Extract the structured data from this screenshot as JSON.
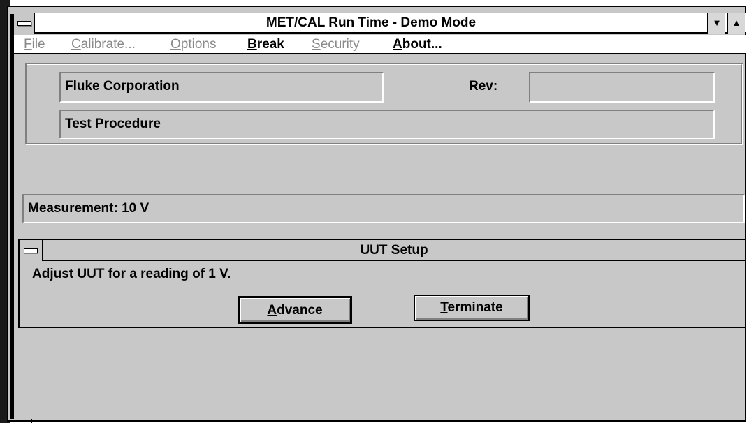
{
  "window": {
    "title": "MET/CAL Run Time - Demo Mode",
    "minimize_glyph": "▼",
    "maximize_glyph": "▲"
  },
  "menu": {
    "items": [
      {
        "underline": "F",
        "rest": "ile",
        "enabled": false
      },
      {
        "underline": "C",
        "rest": "alibrate...",
        "enabled": false
      },
      {
        "underline": "O",
        "rest": "ptions",
        "enabled": false
      },
      {
        "underline": "B",
        "rest": "reak",
        "enabled": true
      },
      {
        "underline": "S",
        "rest": "ecurity",
        "enabled": false
      },
      {
        "underline": "A",
        "rest": "bout...",
        "enabled": true
      }
    ]
  },
  "info": {
    "company": "Fluke Corporation",
    "rev_label": "Rev:",
    "rev_value": "",
    "procedure": "Test Procedure"
  },
  "measurement": {
    "text": "Measurement:  10 V"
  },
  "uut_dialog": {
    "title": "UUT Setup",
    "message": "Adjust UUT for a reading of 1 V.",
    "advance_underline": "A",
    "advance_rest": "dvance",
    "terminate_underline": "T",
    "terminate_rest": "erminate"
  },
  "colors": {
    "window_bg": "#c8c8c8",
    "disabled_text": "#8a8a8a"
  }
}
